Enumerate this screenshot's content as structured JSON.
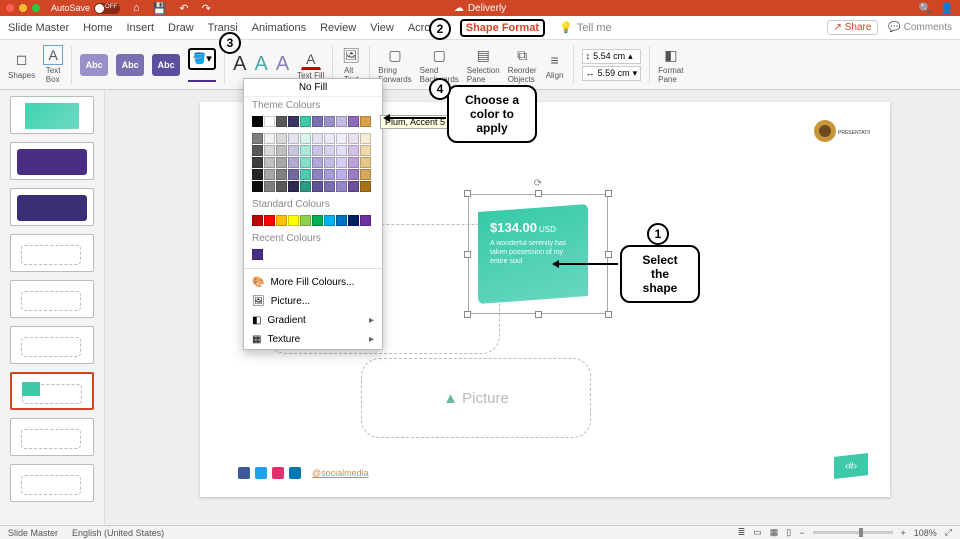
{
  "titlebar": {
    "autosave_label": "AutoSave",
    "autosave_state": "OFF",
    "doc_title": "Deliverly"
  },
  "tabs": {
    "items": [
      "Slide Master",
      "Home",
      "Insert",
      "Draw",
      "Transitions",
      "Animations",
      "Review",
      "View",
      "Acrobat",
      "Shape Format"
    ],
    "active": "Shape Format",
    "tell_me": "Tell me",
    "share": "Share",
    "comments": "Comments"
  },
  "ribbon": {
    "shapes": "Shapes",
    "textbox": "Text\nBox",
    "abc": "Abc",
    "textfill": "Text Fill",
    "alttext": "Alt\nText",
    "bringfwd": "Bring\nForwards",
    "sendback": "Send\nBackwards",
    "selpane": "Selection\nPane",
    "reorder": "Reorder\nObjects",
    "align": "Align",
    "height": "5.54 cm",
    "width": "5.59 cm",
    "formatpane": "Format\nPane"
  },
  "fill_popup": {
    "no_fill": "No Fill",
    "theme_label": "Theme Colours",
    "tooltip": "Plum, Accent 5",
    "standard_label": "Standard Colours",
    "recent_label": "Recent Colours",
    "more": "More Fill Colours...",
    "picture": "Picture...",
    "gradient": "Gradient",
    "texture": "Texture",
    "theme_row1": [
      "#000000",
      "#ffffff",
      "#595959",
      "#3a3263",
      "#3fc9ab",
      "#7a6fb0",
      "#9b8fc9",
      "#c3b9e3",
      "#8e6bb8",
      "#d9a24a"
    ],
    "theme_tints": [
      [
        "#7f7f7f",
        "#f2f2f2",
        "#d9d9d9",
        "#e5e2ef",
        "#d7f3ec",
        "#e5e1f2",
        "#ebe7f6",
        "#f1eefb",
        "#e9e0f2",
        "#f8ecd7"
      ],
      [
        "#595959",
        "#d9d9d9",
        "#bfbfbf",
        "#cbc6e0",
        "#aee8db",
        "#cbc3e6",
        "#d7d0ee",
        "#e3ddf7",
        "#d3c1e6",
        "#f1d9ae"
      ],
      [
        "#3f3f3f",
        "#bfbfbf",
        "#a6a6a6",
        "#b1aad1",
        "#86ddc9",
        "#b1a6d9",
        "#c3b9e5",
        "#d5ccf2",
        "#bda2d9",
        "#eac686"
      ],
      [
        "#262626",
        "#a6a6a6",
        "#808080",
        "#706aa0",
        "#4fcab0",
        "#8e82c4",
        "#a89cd6",
        "#beafe9",
        "#9c7cc4",
        "#d9a75a"
      ],
      [
        "#0d0d0d",
        "#808080",
        "#595959",
        "#2e2850",
        "#2a9a82",
        "#5f5296",
        "#7a6fb0",
        "#9486c9",
        "#6e4f99",
        "#a87219"
      ]
    ],
    "standard": [
      "#c00000",
      "#ff0000",
      "#ffc000",
      "#ffff00",
      "#92d050",
      "#00b050",
      "#00b0f0",
      "#0070c0",
      "#002060",
      "#7030a0"
    ],
    "recent": [
      "#4a2e86"
    ]
  },
  "slide": {
    "price": "$134.00",
    "currency": "USD",
    "blurb": "A wonderful serenity has taken possession of my entire soul",
    "placeholder2": "Picture",
    "social_link": "@socialmedia",
    "logo_text": "PRESENTATIONS",
    "pagenum": "‹#›"
  },
  "callouts": {
    "c1": "Select the\nshape",
    "c2_num": "2",
    "c3_num": "3",
    "c4_num": "4",
    "c1_num": "1",
    "c4": "Choose a\ncolor to apply"
  },
  "status": {
    "view": "Slide Master",
    "lang": "English (United States)",
    "zoom": "108%"
  }
}
